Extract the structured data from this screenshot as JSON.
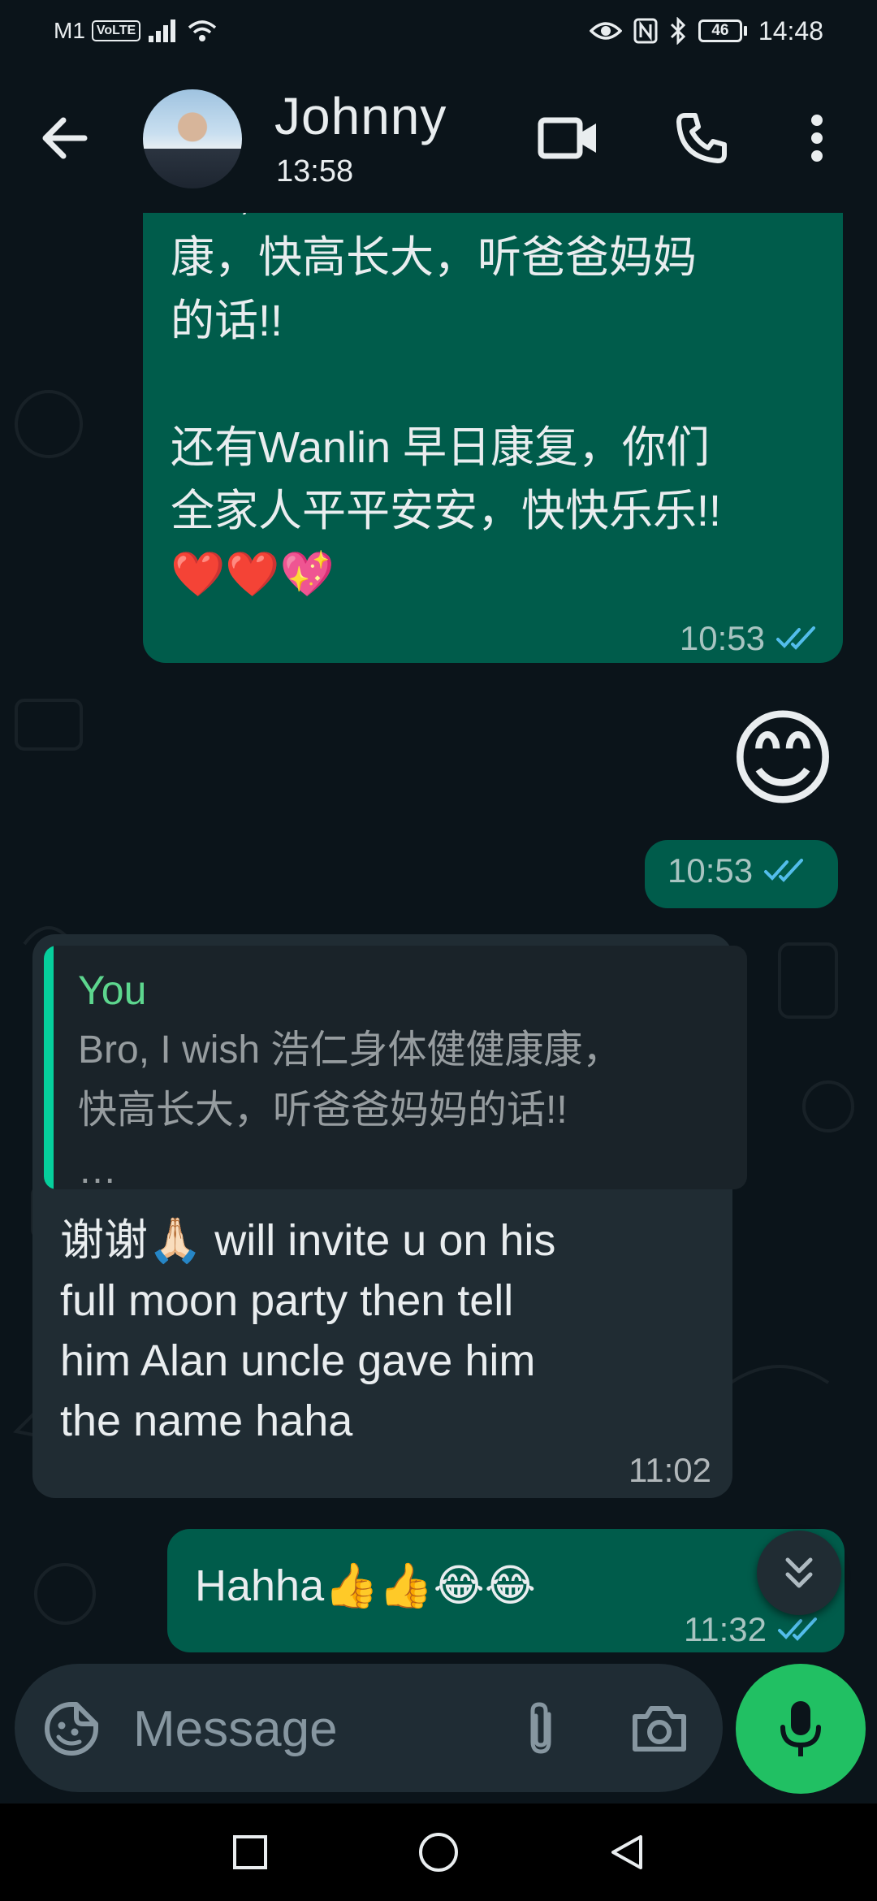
{
  "status_bar": {
    "carrier": "M1",
    "volte": "VoLTE",
    "battery": "46",
    "time": "14:48"
  },
  "header": {
    "contact_name": "Johnny",
    "last_seen": "13:58"
  },
  "messages": [
    {
      "direction": "outgoing",
      "text": "Bro, I wish 浩仁身体健健康\n康，快高长大，听爸爸妈妈\n的话!!\n\n还有Wanlin 早日康复，你们\n全家人平平安安，快快乐乐!!\n❤️❤️💖",
      "time": "10:53",
      "status": "read"
    },
    {
      "direction": "outgoing",
      "text": "😊",
      "time": "10:53",
      "status": "read"
    },
    {
      "direction": "incoming",
      "quote_author": "You",
      "quote_text": "Bro, I wish 浩仁身体健健康康，\n快高长大，听爸爸妈妈的话!!\n…",
      "text": "谢谢🙏🏻 will invite u on his\nfull moon party then tell\nhim Alan uncle gave him\nthe name haha",
      "time": "11:02"
    },
    {
      "direction": "outgoing",
      "text": "Hahha👍👍😂😂",
      "time": "11:32",
      "status": "read"
    }
  ],
  "composer": {
    "placeholder": "Message"
  },
  "icons": {
    "back": "arrow-left",
    "video_call": "video-camera",
    "voice_call": "phone",
    "menu": "three-dots-vertical",
    "emoji": "sticker-smile",
    "attach": "paperclip",
    "camera": "camera",
    "mic": "microphone",
    "scroll_down": "double-chevron-down"
  },
  "colors": {
    "background": "#0b141a",
    "outgoing_bubble": "#005c4b",
    "incoming_bubble": "#202c33",
    "read_ticks": "#53bdeb",
    "mic_button": "#21c063",
    "quote_accent": "#06cf9c"
  }
}
